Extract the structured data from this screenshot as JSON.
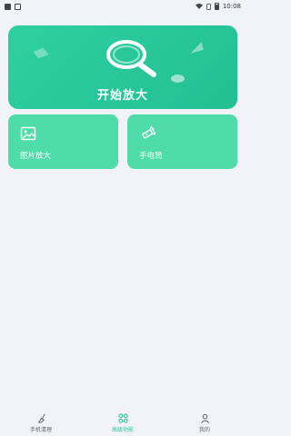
{
  "status_bar": {
    "time": "10:08"
  },
  "hero": {
    "title": "开始放大"
  },
  "cards": [
    {
      "label": "图片放大",
      "icon": "image-icon"
    },
    {
      "label": "手电筒",
      "icon": "flashlight-icon"
    }
  ],
  "bottom_nav": {
    "items": [
      {
        "label": "手机清理",
        "icon": "broom-icon",
        "active": false
      },
      {
        "label": "高级功能",
        "icon": "grid-icon",
        "active": true
      },
      {
        "label": "我的",
        "icon": "user-icon",
        "active": false
      }
    ]
  },
  "colors": {
    "accent": "#2fc89a",
    "hero_bg": "#26c597",
    "card_bg": "#4fdcaa",
    "page_bg": "#f2f3f7"
  }
}
